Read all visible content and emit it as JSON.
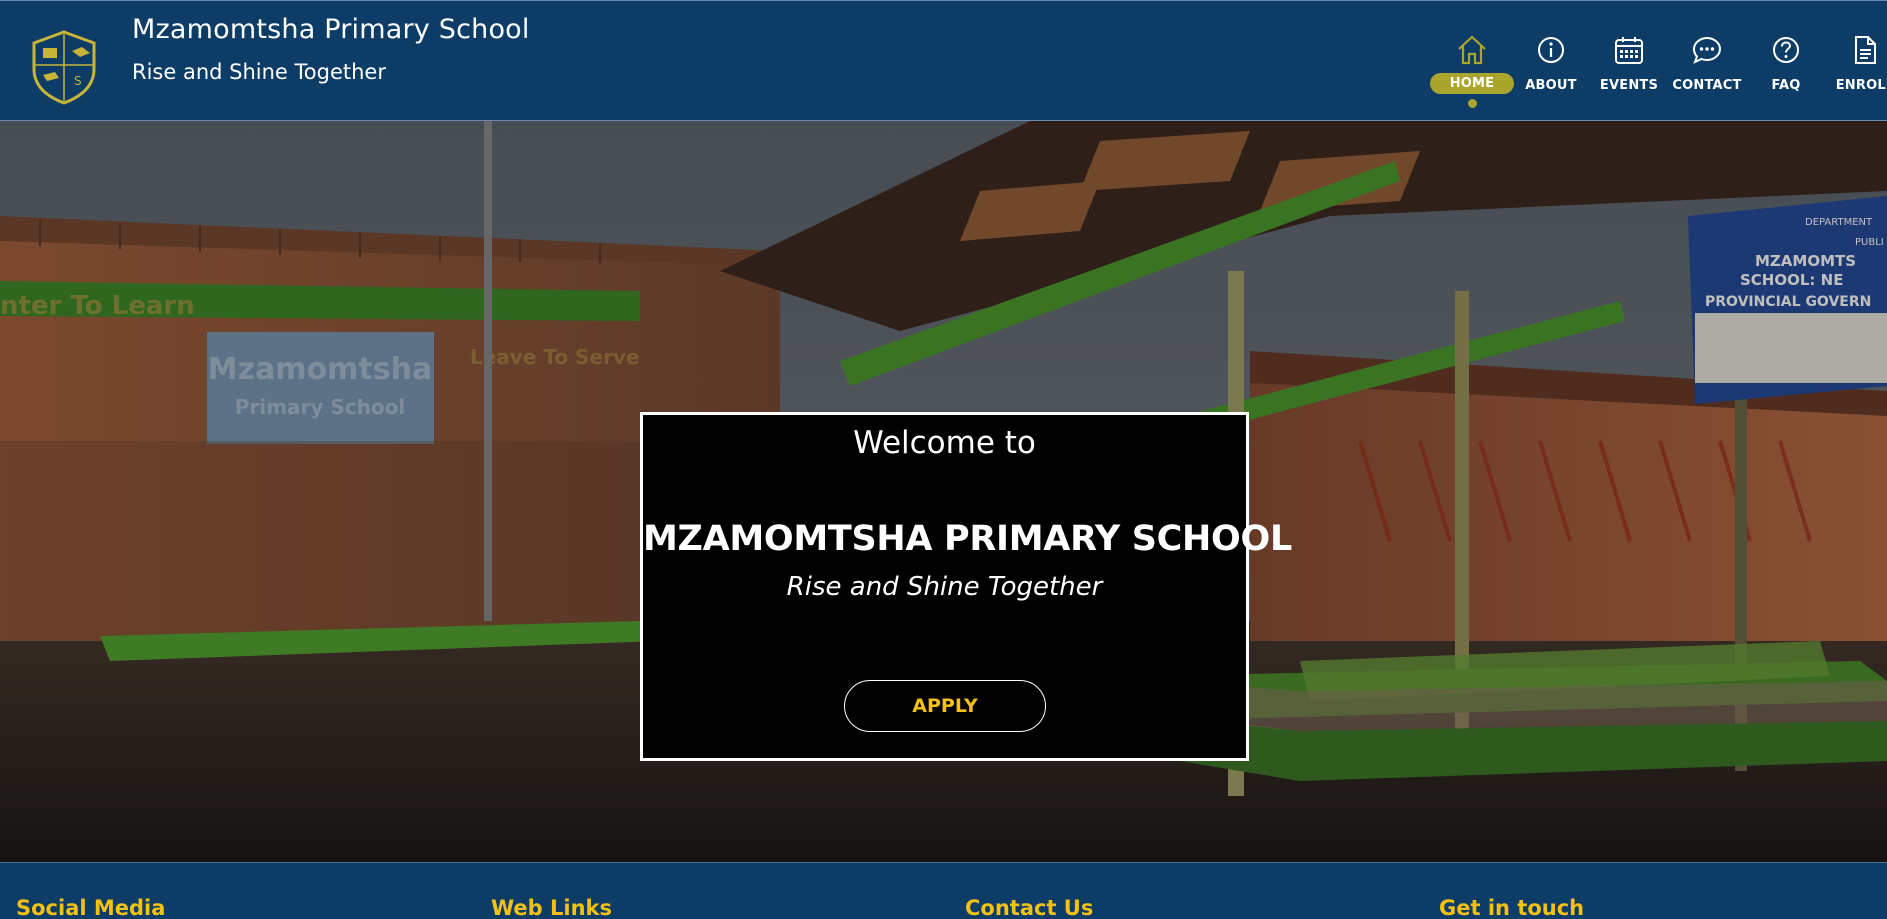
{
  "header": {
    "school_name": "Mzamomtsha Primary School",
    "motto": "Rise and Shine Together",
    "crest_letter": "S"
  },
  "nav": {
    "items": [
      {
        "label": "HOME",
        "icon": "home-icon",
        "active": true
      },
      {
        "label": "ABOUT",
        "icon": "info-icon",
        "active": false
      },
      {
        "label": "EVENTS",
        "icon": "calendar-icon",
        "active": false
      },
      {
        "label": "CONTACT",
        "icon": "chat-bubble-icon",
        "active": false
      },
      {
        "label": "FAQ",
        "icon": "question-icon",
        "active": false
      },
      {
        "label": "ENROLL",
        "icon": "document-icon",
        "active": false
      }
    ]
  },
  "hero": {
    "welcome": "Welcome to",
    "title": "MZAMOMTSHA PRIMARY SCHOOL",
    "motto": "Rise and Shine Together",
    "apply_label": "APPLY",
    "sign_text_1": "Mzamomtsha",
    "sign_text_2": "Primary School",
    "wall_text_1": "nter To Learn",
    "wall_text_2": "Leave To Serve",
    "board_line_1": "DEPARTMENT",
    "board_line_2": "PUBLI",
    "board_line_3": "MZAMOMTS",
    "board_line_4": "SCHOOL: NE",
    "board_line_5": "PROVINCIAL GOVERN"
  },
  "footer": {
    "headings": [
      "Social Media",
      "Web Links",
      "Contact Us",
      "Get in touch"
    ]
  },
  "colors": {
    "navy": "#0d3c67",
    "gold": "#f2c114",
    "olive": "#a9a52d"
  }
}
